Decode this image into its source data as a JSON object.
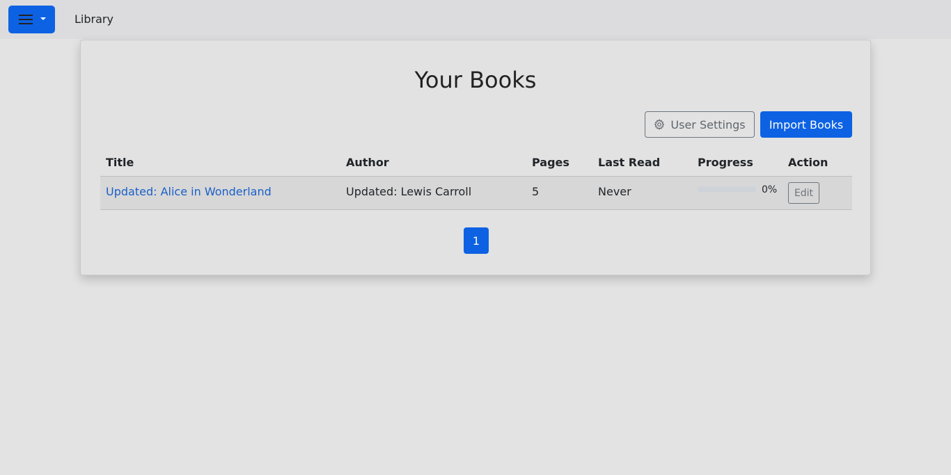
{
  "navbar": {
    "menu_icon": "hamburger-icon",
    "brand": "Library"
  },
  "card": {
    "title": "Your Books",
    "settings_label": "User Settings",
    "settings_icon": "gear-icon",
    "import_label": "Import Books"
  },
  "table": {
    "headers": [
      "Title",
      "Author",
      "Pages",
      "Last Read",
      "Progress",
      "Action"
    ],
    "rows": [
      {
        "title": "Updated: Alice in Wonderland",
        "author": "Updated: Lewis Carroll",
        "pages": "5",
        "last_read": "Never",
        "progress_value": 0,
        "progress_label": "0%",
        "action_label": "Edit"
      }
    ]
  },
  "pagination": {
    "current": "1"
  },
  "colors": {
    "primary": "#0d62e3",
    "link": "#1a5fc8"
  }
}
